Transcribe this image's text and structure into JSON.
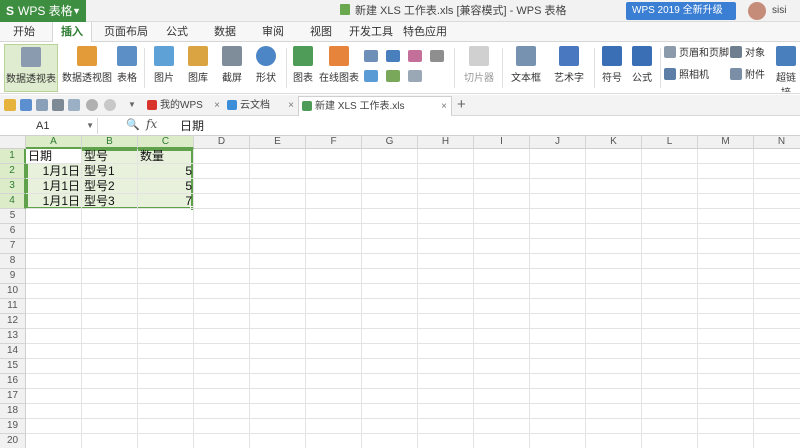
{
  "app": {
    "name": "WPS 表格",
    "logo_letter": "S"
  },
  "window": {
    "title": "新建 XLS 工作表.xls [兼容模式] - WPS 表格"
  },
  "account": {
    "upgrade_label": "WPS 2019 全新升级",
    "username": "sisi"
  },
  "menu": {
    "tabs": [
      "开始",
      "插入",
      "页面布局",
      "公式",
      "数据",
      "审阅",
      "视图",
      "开发工具",
      "特色应用"
    ],
    "active": "插入"
  },
  "ribbon": {
    "pivot_table": "数据透视表",
    "pivot_chart": "数据透视图",
    "table": "表格",
    "picture": "图片",
    "gallery": "图库",
    "screenshot": "截屏",
    "shape": "形状",
    "chart": "图表",
    "online_chart": "在线图表",
    "slicer": "切片器",
    "textbox": "文本框",
    "wordart": "艺术字",
    "symbol": "符号",
    "formula": "公式",
    "header_footer": "页眉和页脚",
    "object": "对象",
    "camera": "照相机",
    "attachment": "附件",
    "hyperlink": "超链接"
  },
  "doc_tabs": [
    {
      "label": "我的WPS",
      "icon": "wps-icon"
    },
    {
      "label": "云文档",
      "icon": "cloud-icon"
    },
    {
      "label": "新建 XLS 工作表.xls",
      "icon": "spreadsheet-icon",
      "active": true
    }
  ],
  "formula_bar": {
    "cell_ref": "A1",
    "fx": "fx",
    "value": "日期"
  },
  "sheet": {
    "columns": [
      "A",
      "B",
      "C",
      "D",
      "E",
      "F",
      "G",
      "H",
      "I",
      "J",
      "K",
      "L",
      "M",
      "N"
    ],
    "row_count": 20,
    "headers": [
      "日期",
      "型号",
      "数量"
    ],
    "rows": [
      [
        "1月1日",
        "型号1",
        "5"
      ],
      [
        "1月1日",
        "型号2",
        "5"
      ],
      [
        "1月1日",
        "型号3",
        "7"
      ]
    ]
  },
  "colors": {
    "brand_green": "#3e8e41",
    "selection_border": "#5fa24b",
    "upgrade_blue": "#3b7fd4"
  }
}
